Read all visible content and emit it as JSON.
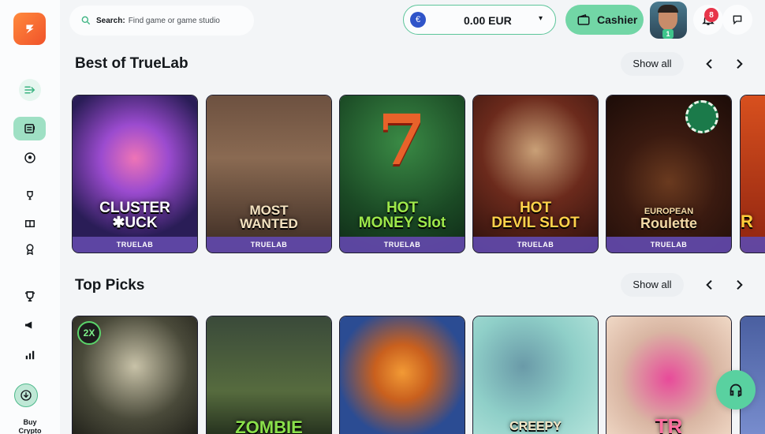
{
  "search": {
    "label": "Search:",
    "placeholder": "Find game or game studio"
  },
  "wallet": {
    "currency_symbol": "€",
    "amount": "0.00",
    "currency": "EUR"
  },
  "cashier": {
    "label": "Cashier"
  },
  "profile": {
    "level": "1"
  },
  "notifications": {
    "count": "8"
  },
  "sidebar": {
    "buy_crypto": "Buy Crypto"
  },
  "sections": [
    {
      "title": "Best of TrueLab",
      "show_all": "Show all",
      "games": [
        {
          "name_l1": "CLUSTER",
          "name_l2": "✱UCK",
          "provider": "TRUELAB",
          "bg": "#4a3a8a"
        },
        {
          "name_l1": "MOST",
          "name_l2": "WANTED",
          "provider": "TRUELAB",
          "bg": "#5b4636"
        },
        {
          "name_l1": "HOT",
          "name_l2": "MONEY Slot",
          "provider": "TRUELAB",
          "bg": "#1f5a2c"
        },
        {
          "name_l1": "HOT",
          "name_l2": "DEVIL SLOT",
          "provider": "TRUELAB",
          "bg": "#4a1e17"
        },
        {
          "name_l1": "EUROPEAN",
          "name_l2": "Roulette",
          "provider": "TRUELAB",
          "bg": "#2a1410"
        },
        {
          "name_l1": "R",
          "name_l2": "",
          "provider": "",
          "bg": "#b33a16"
        }
      ]
    },
    {
      "title": "Top Picks",
      "show_all": "Show all",
      "games": [
        {
          "name_l1": "2X",
          "name_l2": "",
          "provider": "",
          "bg": "#3a3f30"
        },
        {
          "name_l1": "ZOMBIE",
          "name_l2": "",
          "provider": "",
          "bg": "#2d3b2a"
        },
        {
          "name_l1": "",
          "name_l2": "",
          "provider": "",
          "bg": "#2b4c93"
        },
        {
          "name_l1": "CREEPY",
          "name_l2": "",
          "provider": "",
          "bg": "#8fcfc8"
        },
        {
          "name_l1": "TR",
          "name_l2": "",
          "provider": "",
          "bg": "#d9b6a3"
        },
        {
          "name_l1": "",
          "name_l2": "",
          "provider": "",
          "bg": "#5a6ea8"
        }
      ]
    }
  ]
}
